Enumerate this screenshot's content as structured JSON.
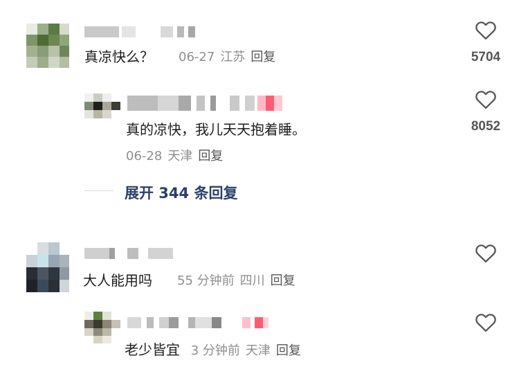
{
  "comments": [
    {
      "text": "真凉快么？",
      "date": "06-27",
      "location": "江苏",
      "reply_label": "回复",
      "likes": "5704",
      "replies": [
        {
          "text": "真的凉快，我儿天天抱着睡。",
          "date": "06-28",
          "location": "天津",
          "reply_label": "回复",
          "likes": "8052"
        }
      ],
      "expand_label": "展开 344 条回复"
    },
    {
      "text": "大人能用吗",
      "date": "55 分钟前",
      "location": "四川",
      "reply_label": "回复",
      "likes": "",
      "replies": [
        {
          "text": "老少皆宜",
          "date": "3 分钟前",
          "location": "天津",
          "reply_label": "回复",
          "likes": ""
        }
      ]
    }
  ],
  "icons": {
    "like": "heart-outline-icon"
  },
  "colors": {
    "text": "#1c1c1c",
    "meta": "#8e8e8e",
    "expand": "#2a3f6b",
    "icon": "#555555"
  }
}
